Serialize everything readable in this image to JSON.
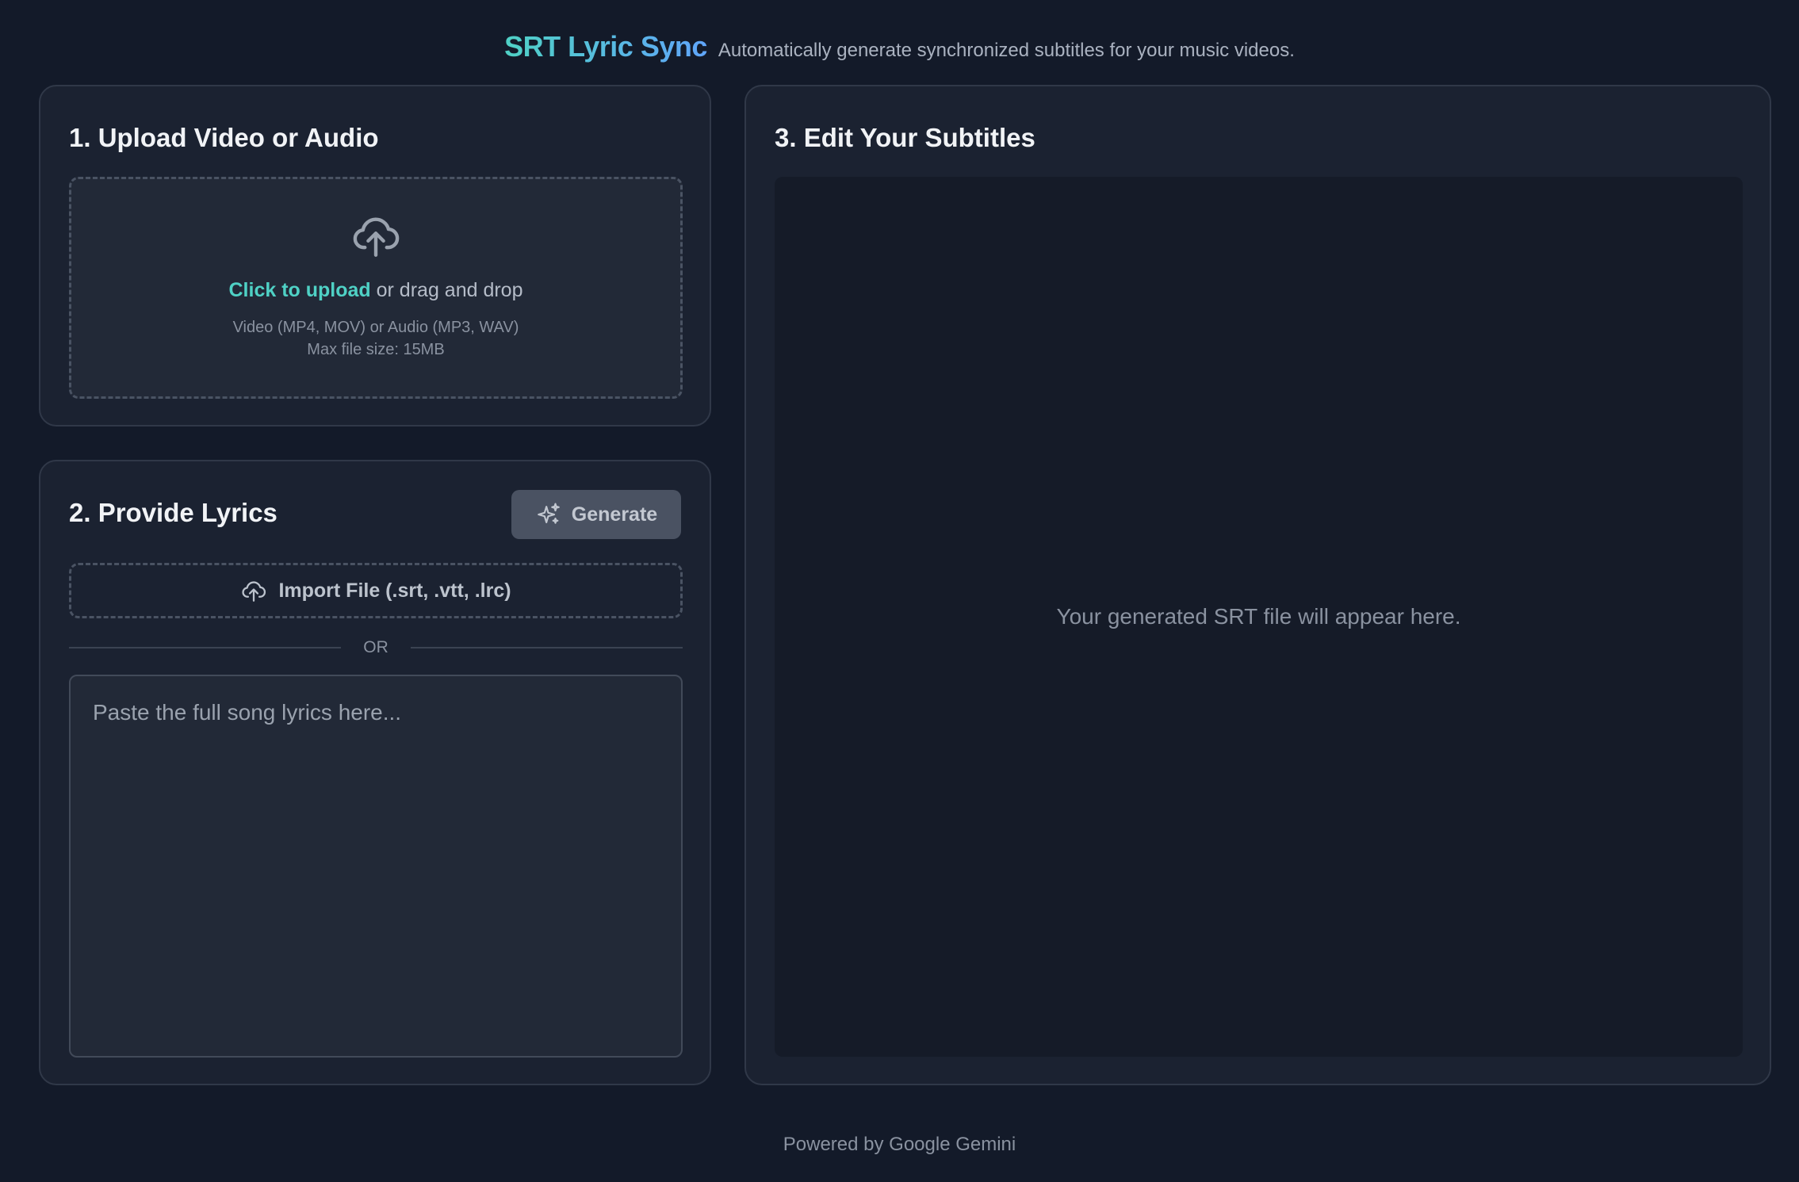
{
  "header": {
    "title": "SRT Lyric Sync",
    "subtitle": "Automatically generate synchronized subtitles for your music videos."
  },
  "upload": {
    "title": "1. Upload Video or Audio",
    "icon": "cloud-upload-icon",
    "link_text": "Click to upload",
    "drag_text": " or drag and drop",
    "formats": "Video (MP4, MOV) or Audio (MP3, WAV)",
    "max_size": "Max file size: 15MB"
  },
  "lyrics": {
    "title": "2. Provide Lyrics",
    "generate_label": "Generate",
    "generate_icon": "sparkles-icon",
    "import_label": "Import File (.srt, .vtt, .lrc)",
    "import_icon": "cloud-upload-icon",
    "divider": "OR",
    "placeholder": "Paste the full song lyrics here..."
  },
  "editor": {
    "title": "3. Edit Your Subtitles",
    "placeholder": "Your generated SRT file will appear here."
  },
  "footer": {
    "text": "Powered by Google Gemini"
  },
  "colors": {
    "accent": "#4fd1c5",
    "gradient_end": "#60a5fa",
    "background": "#131a29",
    "card": "#1b2231"
  }
}
